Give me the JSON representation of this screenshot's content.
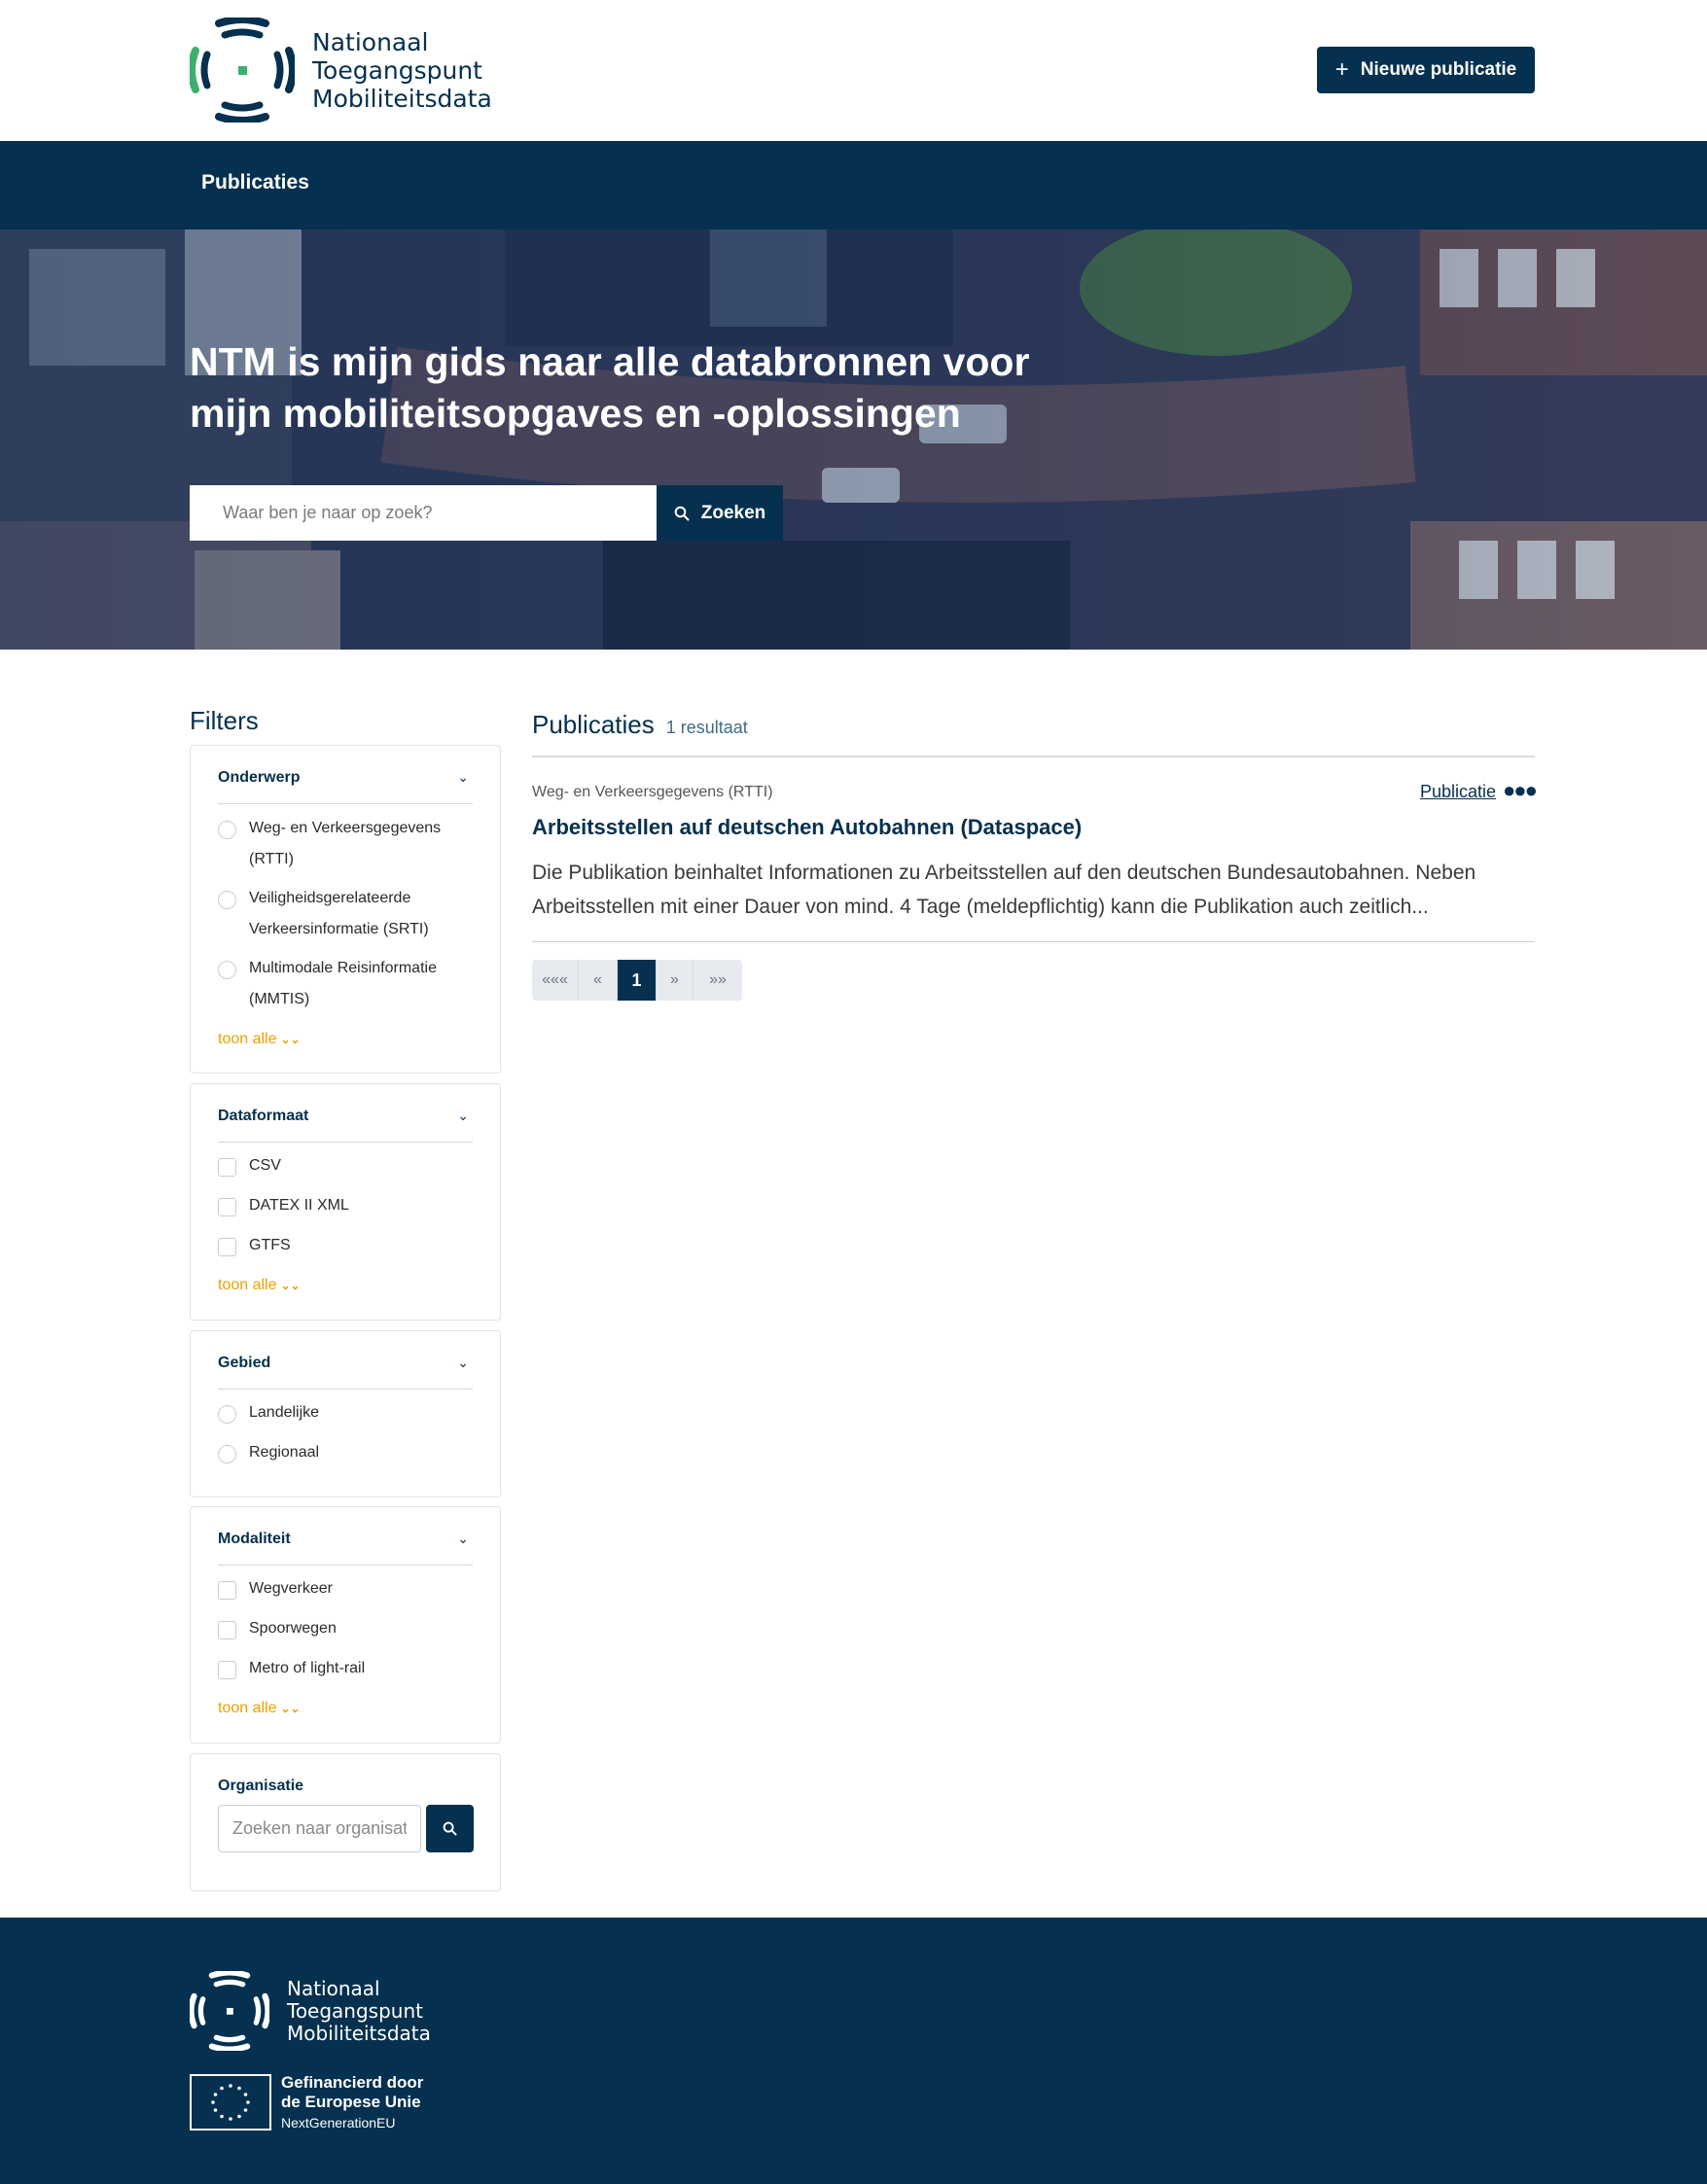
{
  "brand": {
    "line1": "Nationaal",
    "line2": "Toegangspunt",
    "line3": "Mobiliteitsdata"
  },
  "header": {
    "new_publication_label": "Nieuwe publicatie"
  },
  "nav": {
    "items": [
      "Publicaties"
    ]
  },
  "hero": {
    "title": "NTM is mijn gids naar alle databronnen voor mijn mobiliteitsopgaves en -oplossingen",
    "search_placeholder": "Waar ben je naar op zoek?",
    "search_button": "Zoeken"
  },
  "filters": {
    "title": "Filters",
    "show_all_label": "toon alle",
    "groups": [
      {
        "title": "Onderwerp",
        "options": [
          "Weg- en Verkeersgegevens (RTTI)",
          "Veiligheidsgerelateerde Verkeersinformatie (SRTI)",
          "Multimodale Reisinformatie (MMTIS)"
        ]
      },
      {
        "title": "Dataformaat",
        "options": [
          "CSV",
          "DATEX II XML",
          "GTFS"
        ]
      },
      {
        "title": "Gebied",
        "options": [
          "Landelijke",
          "Regionaal"
        ]
      },
      {
        "title": "Modaliteit",
        "options": [
          "Wegverkeer",
          "Spoorwegen",
          "Metro of light-rail"
        ]
      }
    ],
    "organisation": {
      "title": "Organisatie",
      "placeholder": "Zoeken naar organisatie"
    }
  },
  "results": {
    "title": "Publicaties",
    "count": "1 resultaat",
    "items": [
      {
        "category": "Weg- en Verkeersgegevens (RTTI)",
        "type": "Publicatie",
        "title": "Arbeitsstellen auf deutschen Autobahnen (Dataspace)",
        "description": "Die Publikation beinhaltet Informationen zu Arbeitsstellen auf den deutschen Bundesautobahnen. Neben Arbeitsstellen mit einer Dauer von mind. 4 Tage (meldepflichtig) kann die Publikation auch zeitlich..."
      }
    ]
  },
  "pagination": {
    "first": "«««",
    "prev": "«",
    "current": "1",
    "next": "»",
    "last": "»»"
  },
  "footer": {
    "eu_line1": "Gefinancierd door",
    "eu_line2": "de Europese Unie",
    "eu_line3": "NextGenerationEU"
  },
  "colors": {
    "primary": "#05304f",
    "accent": "#e8a200",
    "logo_green": "#3bb06a"
  },
  "icons": {
    "plus": "plus-icon",
    "search": "search-icon",
    "chevron": "chevron-down-icon",
    "double_chevron": "double-chevron-down-icon",
    "more": "more-dots-icon",
    "eu_flag": "eu-flag-icon"
  }
}
